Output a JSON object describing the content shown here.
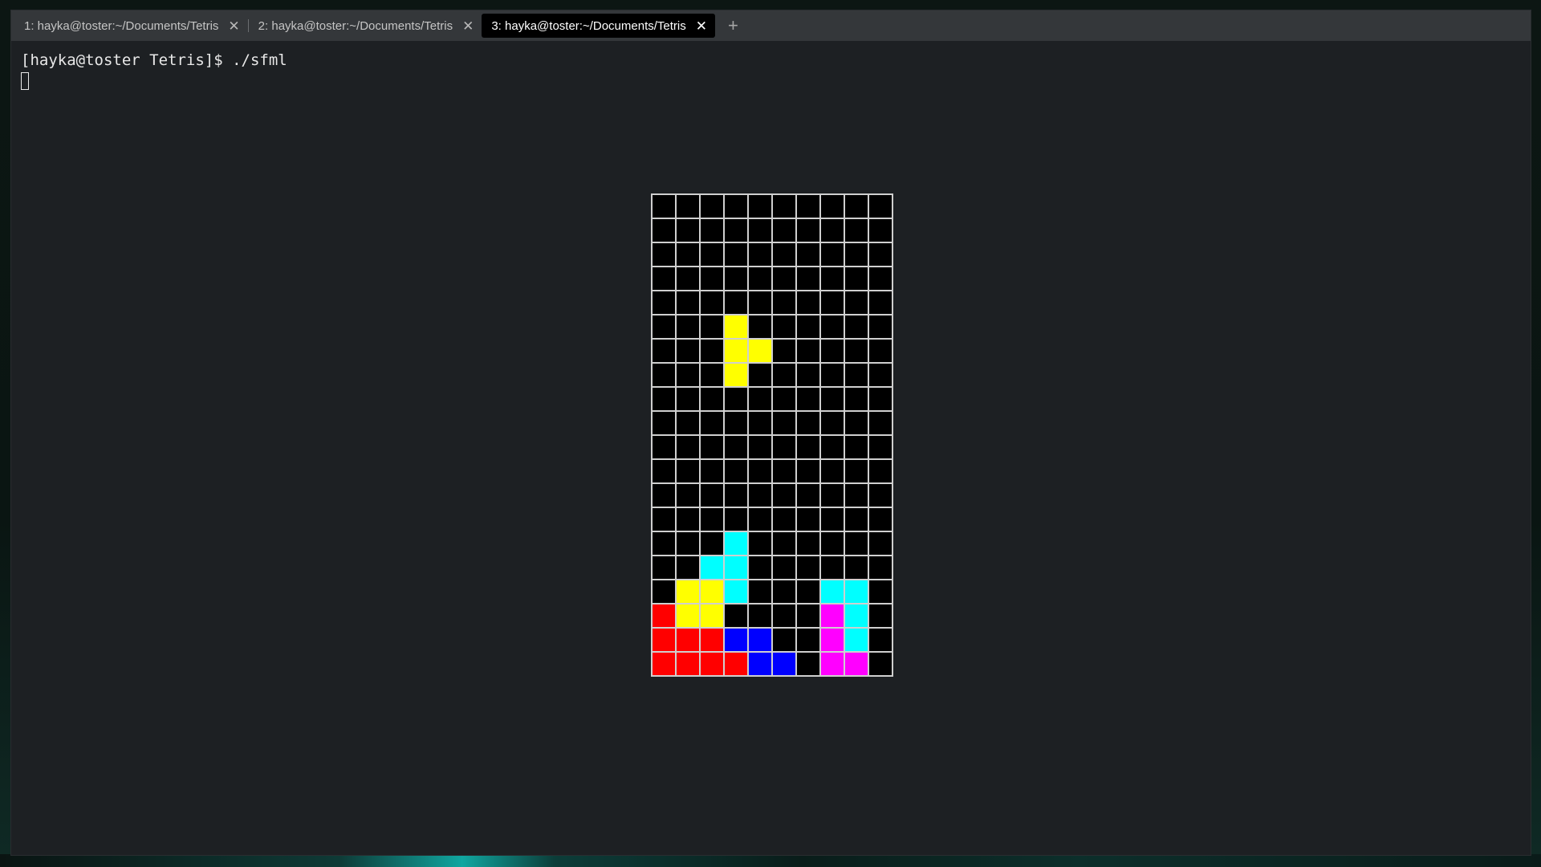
{
  "tabs": [
    {
      "label": "1: hayka@toster:~/Documents/Tetris",
      "active": false
    },
    {
      "label": "2: hayka@toster:~/Documents/Tetris",
      "active": false
    },
    {
      "label": "3: hayka@toster:~/Documents/Tetris",
      "active": true
    }
  ],
  "terminal": {
    "prompt_line": "[hayka@toster Tetris]$ ./sfml"
  },
  "game": {
    "colors": {
      ".": "#000000",
      "Y": "#ffff00",
      "C": "#00ffff",
      "R": "#ff0000",
      "B": "#0000ff",
      "M": "#ff00ff"
    },
    "grid": [
      "..........",
      "..........",
      "..........",
      "..........",
      "..........",
      "...Y......",
      "...YY.....",
      "...Y......",
      "..........",
      "..........",
      "..........",
      "..........",
      "..........",
      "..........",
      "...C......",
      "..CC......",
      ".YYC...CC.",
      "RYY....MC.",
      "RRRBB..MC.",
      "RRRRBB.MM."
    ]
  }
}
